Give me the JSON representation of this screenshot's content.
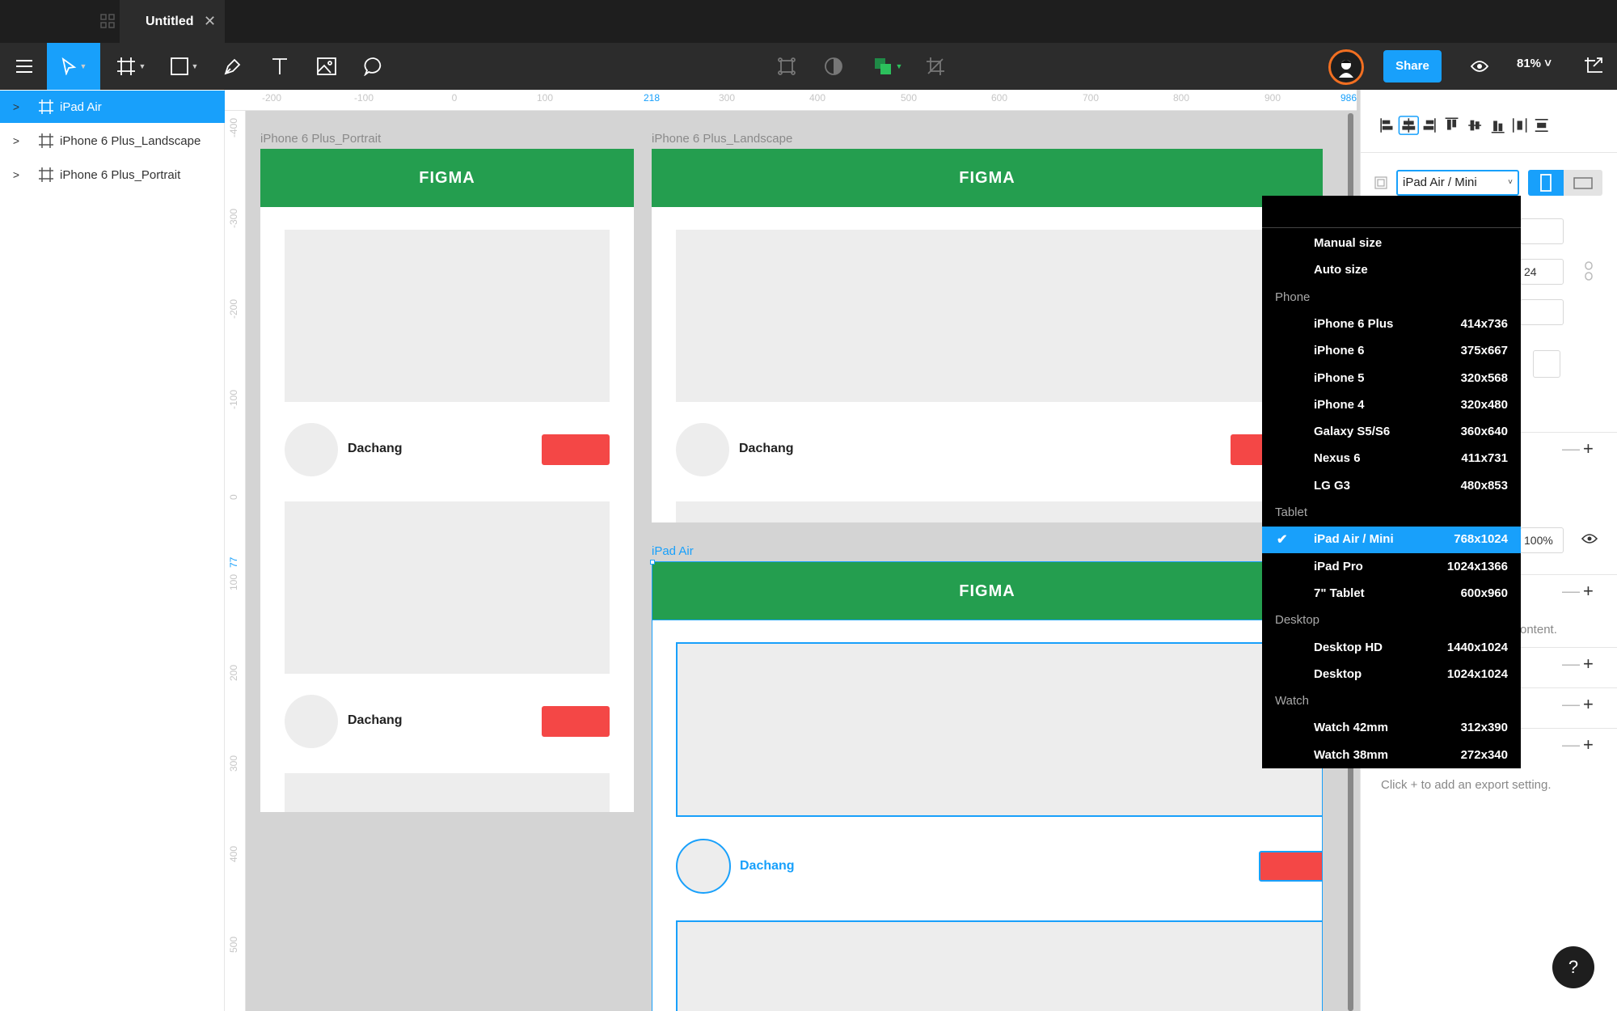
{
  "window": {
    "tab_title": "Untitled",
    "tab_close": "✕"
  },
  "toolbar": {
    "tools": [
      "menu-icon",
      "move-tool",
      "frame-tool",
      "shape-tool",
      "pen-tool",
      "text-tool",
      "image-tool",
      "comment-tool"
    ],
    "share_label": "Share",
    "zoom_label": "81% ˅"
  },
  "layers": [
    {
      "name": "iPad Air",
      "selected": true
    },
    {
      "name": "iPhone 6 Plus_Landscape",
      "selected": false
    },
    {
      "name": "iPhone 6 Plus_Portrait",
      "selected": false
    }
  ],
  "ruler": {
    "top": [
      "-200",
      "-100",
      "0",
      "100",
      "218",
      "300",
      "400",
      "500",
      "600",
      "700",
      "800",
      "900",
      "986"
    ],
    "left": [
      "-400",
      "-300",
      "-200",
      "-100",
      "0",
      "77",
      "100",
      "200",
      "300",
      "400",
      "500"
    ],
    "highlight_top": [
      "218",
      "986"
    ],
    "highlight_left": [
      "77"
    ]
  },
  "frames": {
    "portrait": {
      "label": "iPhone 6 Plus_Portrait",
      "header": "FIGMA",
      "rows": [
        {
          "name": "Dachang"
        },
        {
          "name": "Dachang"
        }
      ]
    },
    "landscape": {
      "label": "iPhone 6 Plus_Landscape",
      "header": "FIGMA",
      "rows": [
        {
          "name": "Dachang"
        }
      ]
    },
    "ipad": {
      "label": "iPad Air",
      "header": "FIGMA",
      "rows": [
        {
          "name": "Dachang"
        }
      ]
    }
  },
  "props": {
    "device_select": "iPad Air / Mini",
    "height_partial": "24",
    "opacity_value": "100%",
    "content_partial": "ontent.",
    "export_hint": "Click + to add an export setting.",
    "help": "?"
  },
  "device_menu": {
    "items": [
      {
        "type": "item",
        "label": "Manual size",
        "size": ""
      },
      {
        "type": "item",
        "label": "Auto size",
        "size": ""
      },
      {
        "type": "group",
        "label": "Phone"
      },
      {
        "type": "item",
        "label": "iPhone 6 Plus",
        "size": "414x736"
      },
      {
        "type": "item",
        "label": "iPhone 6",
        "size": "375x667"
      },
      {
        "type": "item",
        "label": "iPhone 5",
        "size": "320x568"
      },
      {
        "type": "item",
        "label": "iPhone 4",
        "size": "320x480"
      },
      {
        "type": "item",
        "label": "Galaxy S5/S6",
        "size": "360x640"
      },
      {
        "type": "item",
        "label": "Nexus 6",
        "size": "411x731"
      },
      {
        "type": "item",
        "label": "LG G3",
        "size": "480x853"
      },
      {
        "type": "group",
        "label": "Tablet"
      },
      {
        "type": "item",
        "label": "iPad Air / Mini",
        "size": "768x1024",
        "selected": true
      },
      {
        "type": "item",
        "label": "iPad Pro",
        "size": "1024x1366"
      },
      {
        "type": "item",
        "label": "7\" Tablet",
        "size": "600x960"
      },
      {
        "type": "group",
        "label": "Desktop"
      },
      {
        "type": "item",
        "label": "Desktop HD",
        "size": "1440x1024"
      },
      {
        "type": "item",
        "label": "Desktop",
        "size": "1024x1024"
      },
      {
        "type": "group",
        "label": "Watch"
      },
      {
        "type": "item",
        "label": "Watch 42mm",
        "size": "312x390"
      },
      {
        "type": "item",
        "label": "Watch 38mm",
        "size": "272x340"
      }
    ]
  },
  "colors": {
    "accent": "#18a0fb",
    "header_green": "#249e4f",
    "button_red": "#f44746",
    "avatar_ring": "#f26f21"
  }
}
